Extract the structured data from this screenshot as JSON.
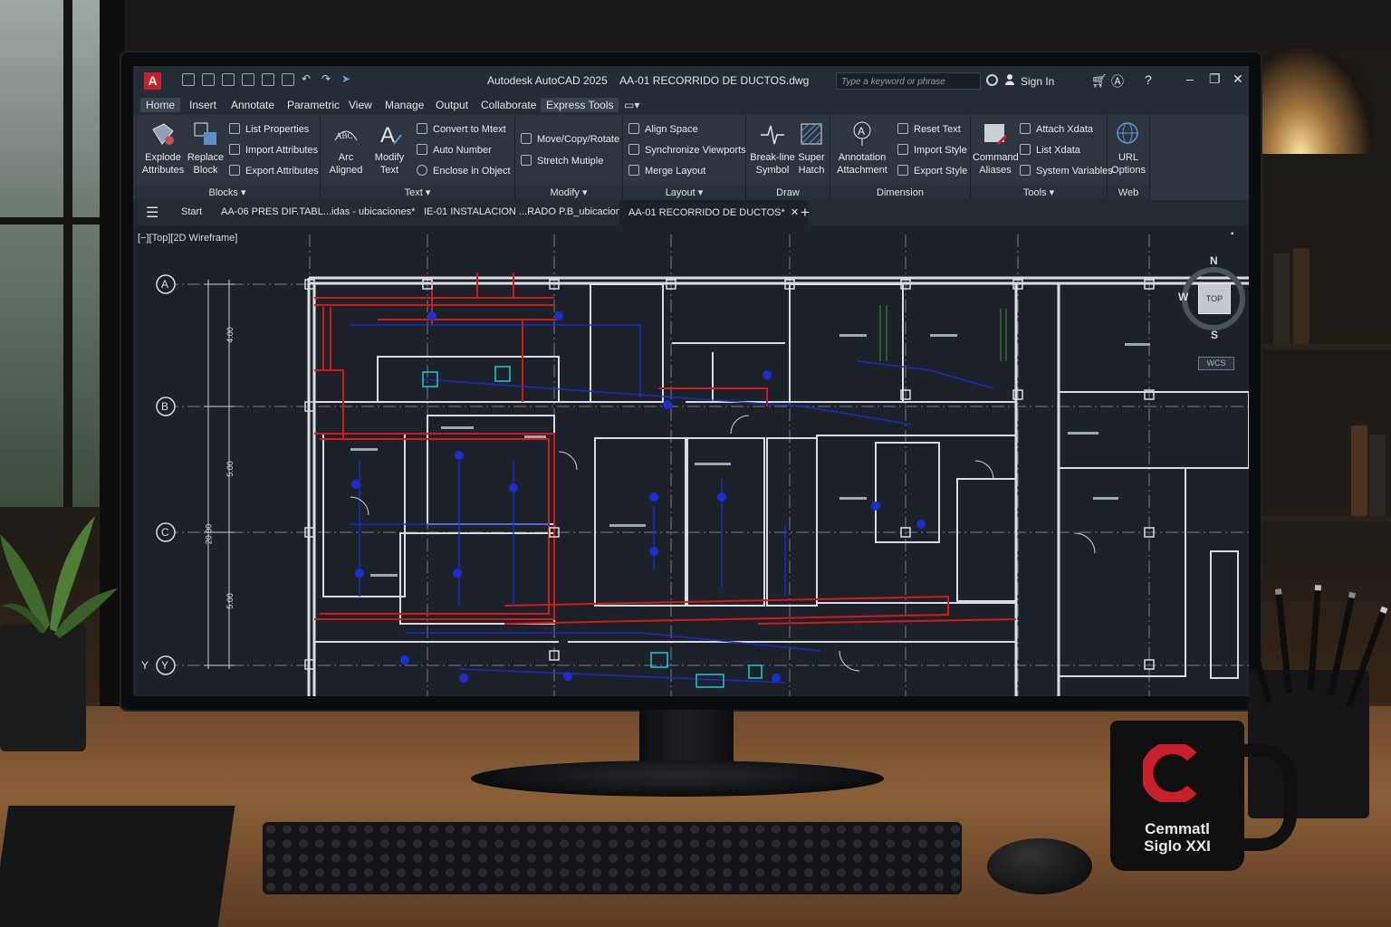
{
  "window": {
    "title": "Autodesk AutoCAD 2025",
    "file_name": "AA-01 RECORRIDO DE DUCTOS.dwg",
    "app_icon_letter": "A",
    "search_placeholder": "Type a keyword or phrase",
    "sign_in": "Sign In"
  },
  "ribbon_tabs": [
    "Home",
    "Insert",
    "Annotate",
    "Parametric",
    "View",
    "Manage",
    "Output",
    "Collaborate",
    "Express Tools"
  ],
  "ribbon": {
    "blocks": {
      "title": "Blocks",
      "explode": [
        "Explode",
        "Attributes"
      ],
      "replace": [
        "Replace",
        "Block"
      ],
      "list_properties": "List Properties",
      "import_attributes": "Import Attributes",
      "export_attributes": "Export Attributes"
    },
    "text": {
      "title": "Text",
      "arc": [
        "Arc",
        "Aligned"
      ],
      "modify": [
        "Modify",
        "Text"
      ],
      "convert": "Convert to Mtext",
      "auto_number": "Auto Number",
      "enclose": "Enclose in Object"
    },
    "modify": {
      "title": "Modify",
      "move_copy": "Move/Copy/Rotate",
      "stretch": "Stretch Mutiple"
    },
    "layout": {
      "title": "Layout",
      "align_space": "Align Space",
      "sync": "Synchronize Viewports",
      "merge": "Merge Layout"
    },
    "draw": {
      "title": "Draw",
      "breakline": [
        "Break-line",
        "Symbol"
      ],
      "super_hatch": [
        "Super",
        "Hatch"
      ]
    },
    "dimension": {
      "title": "Dimension",
      "annotation": [
        "Annotation",
        "Attachment"
      ],
      "reset_text": "Reset Text",
      "import_style": "Import Style",
      "export_style": "Export Style"
    },
    "tools": {
      "title": "Tools",
      "command": [
        "Command",
        "Aliases"
      ],
      "attach_xdata": "Attach Xdata",
      "list_xdata": "List Xdata",
      "system_variables": "System Variables"
    },
    "web": {
      "title": "Web",
      "url": [
        "URL",
        "Options"
      ]
    }
  },
  "doc_tabs": {
    "start": "Start",
    "tab1": "AA-06 PRES DIF.TABL...idas - ubicaciones*",
    "tab2": "IE-01 INSTALACION ...RADO P.B_ubicacion",
    "active": "AA-01 RECORRIDO DE DUCTOS*"
  },
  "viewport": {
    "label": "[−][Top][2D Wireframe]",
    "grid_rows": [
      "A",
      "B",
      "C",
      "Y"
    ],
    "row_prefix": "Y",
    "dims": [
      "4.00",
      "5.00",
      "5.00",
      "20.00"
    ],
    "viewcube": {
      "n": "N",
      "w": "W",
      "s": "S",
      "top": "TOP",
      "wcs": "WCS"
    }
  },
  "mug": {
    "line1": "Cemmatl",
    "line2": "Siglo XXI"
  },
  "colors": {
    "autocad_red": "#c8202b",
    "duct_red": "#d11a1a",
    "duct_blue": "#1a2ed6",
    "cyan": "#1fc8d8",
    "wall": "#d9dde2"
  }
}
